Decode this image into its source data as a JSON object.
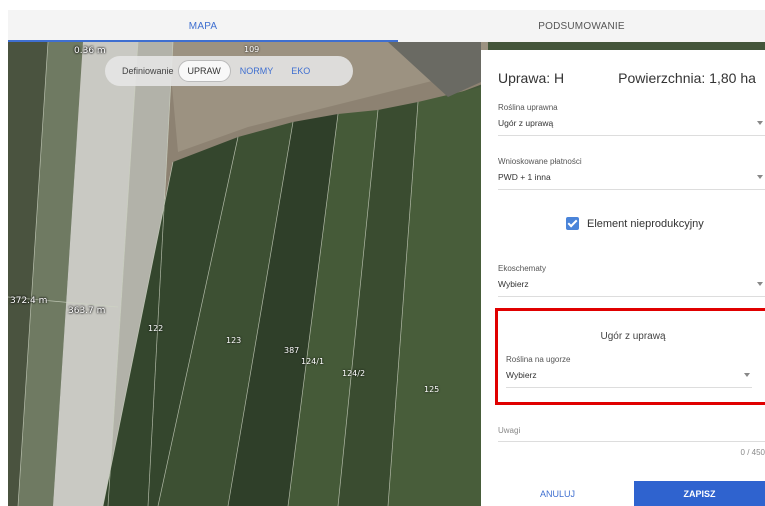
{
  "tabs": {
    "map": "MAPA",
    "summary": "PODSUMOWANIE"
  },
  "definiowanie": {
    "label": "Definiowanie",
    "options": [
      "UPRAW",
      "NORMY",
      "EKO"
    ],
    "active": "UPRAW"
  },
  "map": {
    "parcels": [
      "109",
      "122",
      "123",
      "387",
      "124/1",
      "124/2",
      "125"
    ],
    "measures": [
      "0.36 m",
      "372.4 m",
      "363.7 m"
    ]
  },
  "panel": {
    "title": "Uprawa: H",
    "area": "Powierzchnia: 1,80 ha",
    "crop": {
      "label": "Roślina uprawna",
      "value": "Ugór z uprawą"
    },
    "payments": {
      "label": "Wnioskowane płatności",
      "value": "PWD + 1 inna"
    },
    "nonproductive": {
      "label": "Element nieprodukcyjny",
      "checked": true
    },
    "ecoschemes": {
      "label": "Ekoschematy",
      "value": "Wybierz"
    },
    "fallow": {
      "title": "Ugór z uprawą",
      "plant_label": "Roślina na ugorze",
      "plant_value": "Wybierz"
    },
    "notes": {
      "placeholder": "Uwagi",
      "counter": "0 / 450"
    },
    "buttons": {
      "cancel": "ANULUJ",
      "save": "ZAPISZ"
    }
  },
  "colors": {
    "accent": "#3f6fd0",
    "save": "#2f63cf",
    "highlight": "#e00000"
  }
}
